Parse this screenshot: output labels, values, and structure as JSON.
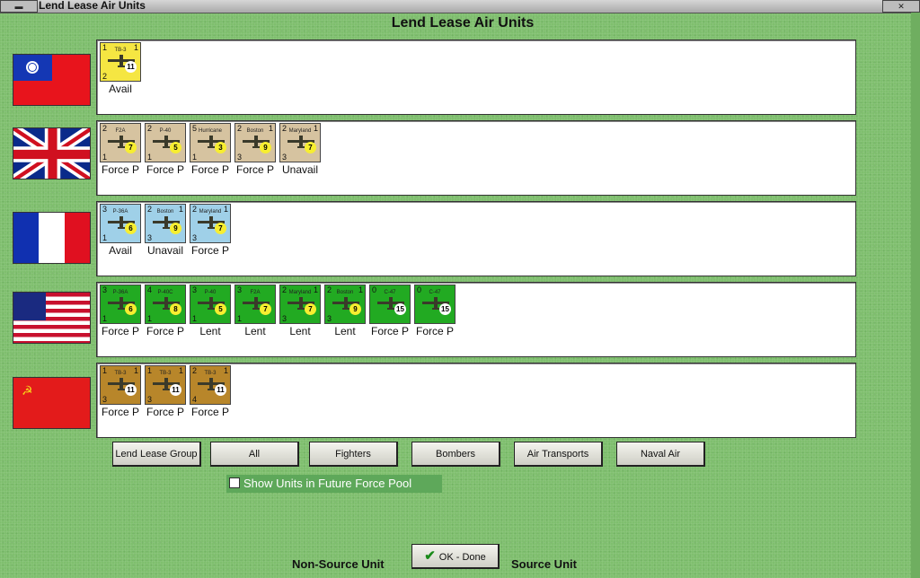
{
  "window": {
    "title": "Lend Lease Air Units",
    "menu_icon": "window-menu-icon",
    "close_icon": "close-icon"
  },
  "heading": "Lend Lease Air Units",
  "colors": {
    "background": "#7fbf6e",
    "avail_counter": "#f5e642",
    "commonwealth_counter": "#d6c3a0",
    "france_counter": "#9fd0e8",
    "usa_counter": "#22aa22",
    "ussr_counter": "#b8862a"
  },
  "nations": [
    {
      "flag": "china-flag-icon",
      "units": [
        {
          "name": "TB-3",
          "top_left": "1",
          "top_right": "1",
          "bottom_left": "2",
          "badge": "11",
          "status": "Avail"
        }
      ]
    },
    {
      "flag": "uk-flag-icon",
      "units": [
        {
          "name": "F2A",
          "top_left": "2",
          "top_right": "",
          "bottom_left": "1",
          "badge": "7",
          "status": "Force P"
        },
        {
          "name": "P-40",
          "top_left": "2",
          "top_right": "",
          "bottom_left": "1",
          "badge": "5",
          "status": "Force P"
        },
        {
          "name": "Hurricane",
          "top_left": "5",
          "top_right": "",
          "bottom_left": "1",
          "badge": "3",
          "status": "Force P"
        },
        {
          "name": "Boston",
          "top_left": "2",
          "top_right": "1",
          "bottom_left": "3",
          "badge": "9",
          "status": "Force P"
        },
        {
          "name": "Maryland",
          "top_left": "2",
          "top_right": "1",
          "bottom_left": "3",
          "badge": "7",
          "status": "Unavail"
        }
      ]
    },
    {
      "flag": "france-flag-icon",
      "units": [
        {
          "name": "P-36A",
          "top_left": "3",
          "top_right": "",
          "bottom_left": "1",
          "badge": "6",
          "status": "Avail"
        },
        {
          "name": "Boston",
          "top_left": "2",
          "top_right": "1",
          "bottom_left": "3",
          "badge": "9",
          "status": "Unavail"
        },
        {
          "name": "Maryland",
          "top_left": "2",
          "top_right": "1",
          "bottom_left": "3",
          "badge": "7",
          "status": "Force P"
        }
      ]
    },
    {
      "flag": "usa-flag-icon",
      "units": [
        {
          "name": "P-36A",
          "top_left": "3",
          "top_right": "",
          "bottom_left": "1",
          "badge": "6",
          "status": "Force P"
        },
        {
          "name": "P-40C",
          "top_left": "4",
          "top_right": "",
          "bottom_left": "1",
          "badge": "8",
          "status": "Force P"
        },
        {
          "name": "P-40",
          "top_left": "3",
          "top_right": "",
          "bottom_left": "1",
          "badge": "5",
          "status": "Lent"
        },
        {
          "name": "F2A",
          "top_left": "3",
          "top_right": "",
          "bottom_left": "1",
          "badge": "7",
          "status": "Lent"
        },
        {
          "name": "Maryland",
          "top_left": "2",
          "top_right": "1",
          "bottom_left": "3",
          "badge": "7",
          "status": "Lent"
        },
        {
          "name": "Boston",
          "top_left": "2",
          "top_right": "1",
          "bottom_left": "3",
          "badge": "9",
          "status": "Lent"
        },
        {
          "name": "C-47",
          "top_left": "0",
          "top_right": "",
          "bottom_left": "",
          "badge": "15",
          "status": "Force P"
        },
        {
          "name": "C-47",
          "top_left": "0",
          "top_right": "",
          "bottom_left": "",
          "badge": "15",
          "status": "Force P"
        }
      ]
    },
    {
      "flag": "ussr-flag-icon",
      "units": [
        {
          "name": "TB-3",
          "top_left": "1",
          "top_right": "1",
          "bottom_left": "3",
          "badge": "11",
          "status": "Force P"
        },
        {
          "name": "TB-3",
          "top_left": "1",
          "top_right": "1",
          "bottom_left": "3",
          "badge": "11",
          "status": "Force P"
        },
        {
          "name": "TB-3",
          "top_left": "2",
          "top_right": "1",
          "bottom_left": "4",
          "badge": "11",
          "status": "Force P"
        }
      ]
    }
  ],
  "filters": {
    "lend_lease_group": "Lend Lease Group",
    "all": "All",
    "fighters": "Fighters",
    "bombers": "Bombers",
    "air_transports": "Air Transports",
    "naval_air": "Naval Air"
  },
  "future_pool": {
    "label": "Show Units in Future Force Pool",
    "checked": false
  },
  "legend": {
    "non_source": "Non-Source Unit",
    "source": "Source Unit"
  },
  "ok_button": "OK - Done"
}
